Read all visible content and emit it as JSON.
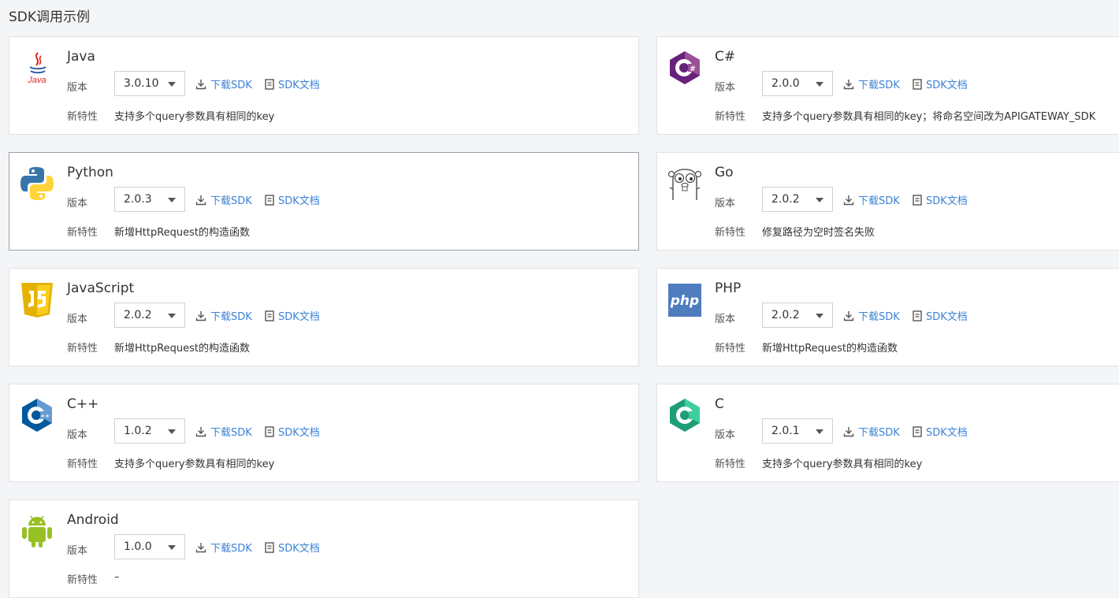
{
  "page_title": "SDK调用示例",
  "labels": {
    "version": "版本",
    "features": "新特性",
    "download": "下载SDK",
    "docs": "SDK文档"
  },
  "colors": {
    "link": "#3b82d6",
    "background": "#f4f5f7",
    "card_border": "#dfe1e6"
  },
  "sdks": [
    {
      "name": "Java",
      "version": "3.0.10",
      "features": "支持多个query参数具有相同的key",
      "icon": "java-icon"
    },
    {
      "name": "C#",
      "version": "2.0.0",
      "features": "支持多个query参数具有相同的key；将命名空间改为APIGATEWAY_SDK",
      "icon": "csharp-icon"
    },
    {
      "name": "Python",
      "version": "2.0.3",
      "features": "新增HttpRequest的构造函数",
      "icon": "python-icon"
    },
    {
      "name": "Go",
      "version": "2.0.2",
      "features": "修复路径为空时签名失败",
      "icon": "go-gopher-icon"
    },
    {
      "name": "JavaScript",
      "version": "2.0.2",
      "features": "新增HttpRequest的构造函数",
      "icon": "javascript-icon"
    },
    {
      "name": "PHP",
      "version": "2.0.2",
      "features": "新增HttpRequest的构造函数",
      "icon": "php-icon"
    },
    {
      "name": "C++",
      "version": "1.0.2",
      "features": "支持多个query参数具有相同的key",
      "icon": "cpp-icon"
    },
    {
      "name": "C",
      "version": "2.0.1",
      "features": "支持多个query参数具有相同的key",
      "icon": "c-icon"
    },
    {
      "name": "Android",
      "version": "1.0.0",
      "features": "–",
      "icon": "android-icon"
    }
  ]
}
